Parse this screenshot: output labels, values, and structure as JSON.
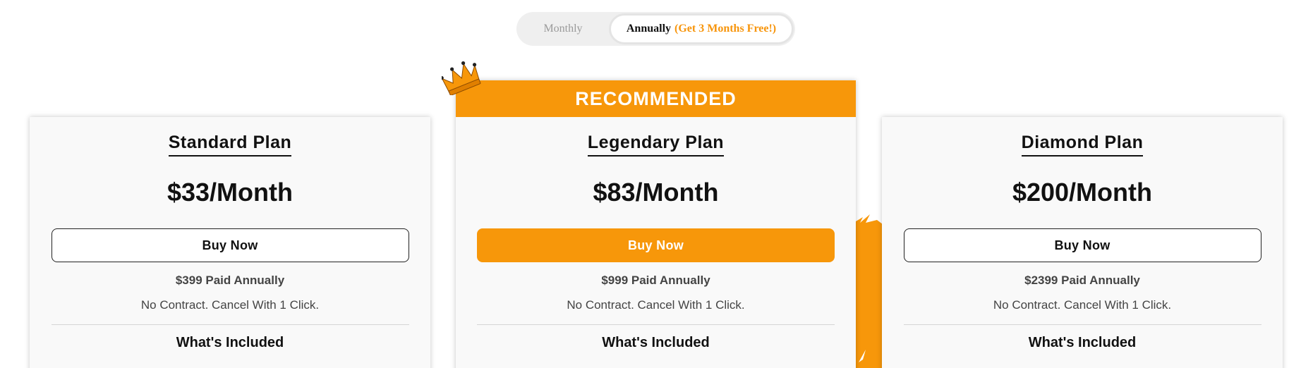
{
  "billing_toggle": {
    "monthly_label": "Monthly",
    "annual_label": "Annually",
    "annual_promo": "(Get 3 Months Free!)",
    "selected": "Annually"
  },
  "plans": [
    {
      "name": "Standard Plan",
      "price": "$33/Month",
      "buy_label": "Buy Now",
      "paid_annually": "$399 Paid Annually",
      "contract_note": "No Contract. Cancel With 1 Click.",
      "included_heading": "What's Included"
    },
    {
      "ribbon": "RECOMMENDED",
      "name": "Legendary Plan",
      "price": "$83/Month",
      "buy_label": "Buy Now",
      "paid_annually": "$999 Paid Annually",
      "contract_note": "No Contract. Cancel With 1 Click.",
      "included_heading": "What's Included"
    },
    {
      "name": "Diamond Plan",
      "price": "$200/Month",
      "buy_label": "Buy Now",
      "paid_annually": "$2399 Paid Annually",
      "contract_note": "No Contract. Cancel With 1 Click.",
      "included_heading": "What's Included"
    }
  ],
  "icons": {
    "crown": "crown-icon",
    "brush": "brush-stroke-decoration"
  },
  "colors": {
    "accent": "#f7970a",
    "promo_text": "#f7950c",
    "card_background": "#f9f9f9",
    "muted_text": "#9a9a9a"
  }
}
